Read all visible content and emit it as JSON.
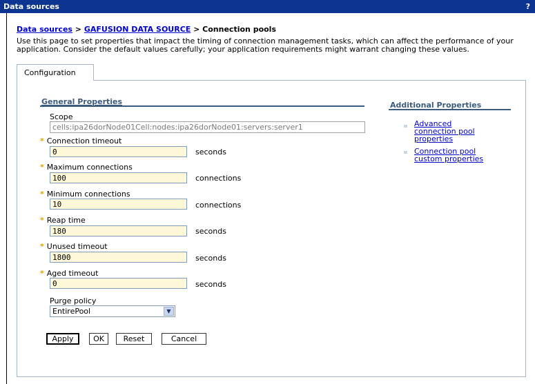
{
  "window": {
    "title": "Data sources",
    "help": "?"
  },
  "breadcrumb": {
    "link1": "Data sources",
    "sep1": " > ",
    "link2": "GAFUSION DATA SOURCE",
    "sep2": " > ",
    "current": "Connection pools"
  },
  "description": "Use this page to set properties that impact the timing of connection management tasks, which can affect the performance of your application. Consider the default values carefully; your application requirements might warrant changing these values.",
  "tabs": {
    "configuration": "Configuration"
  },
  "general": {
    "title": "General Properties",
    "scope_label": "Scope",
    "scope_value": "cells:ipa26dorNode01Cell:nodes:ipa26dorNode01:servers:server1",
    "required_marker": "*",
    "fields": [
      {
        "label": "Connection timeout",
        "value": "0",
        "unit": "seconds"
      },
      {
        "label": "Maximum connections",
        "value": "100",
        "unit": "connections"
      },
      {
        "label": "Minimum connections",
        "value": "10",
        "unit": "connections"
      },
      {
        "label": "Reap time",
        "value": "180",
        "unit": "seconds"
      },
      {
        "label": "Unused timeout",
        "value": "1800",
        "unit": "seconds"
      },
      {
        "label": "Aged timeout",
        "value": "0",
        "unit": "seconds"
      }
    ],
    "purge_label": "Purge policy",
    "purge_value": "EntirePool",
    "select_arrow": "▼"
  },
  "additional": {
    "title": "Additional Properties",
    "links": [
      {
        "line1": "Advanced",
        "line2": "connection pool",
        "line3": "properties"
      },
      {
        "line1": "Connection pool",
        "line2": "custom properties"
      }
    ]
  },
  "buttons": {
    "apply": "Apply",
    "ok": "OK",
    "reset": "Reset",
    "cancel": "Cancel"
  },
  "colors": {
    "titlebar": "#0c3490",
    "link": "#0000cc",
    "section": "#3c5a7c",
    "input_bg": "#fff8d8",
    "required": "#d6a600"
  }
}
